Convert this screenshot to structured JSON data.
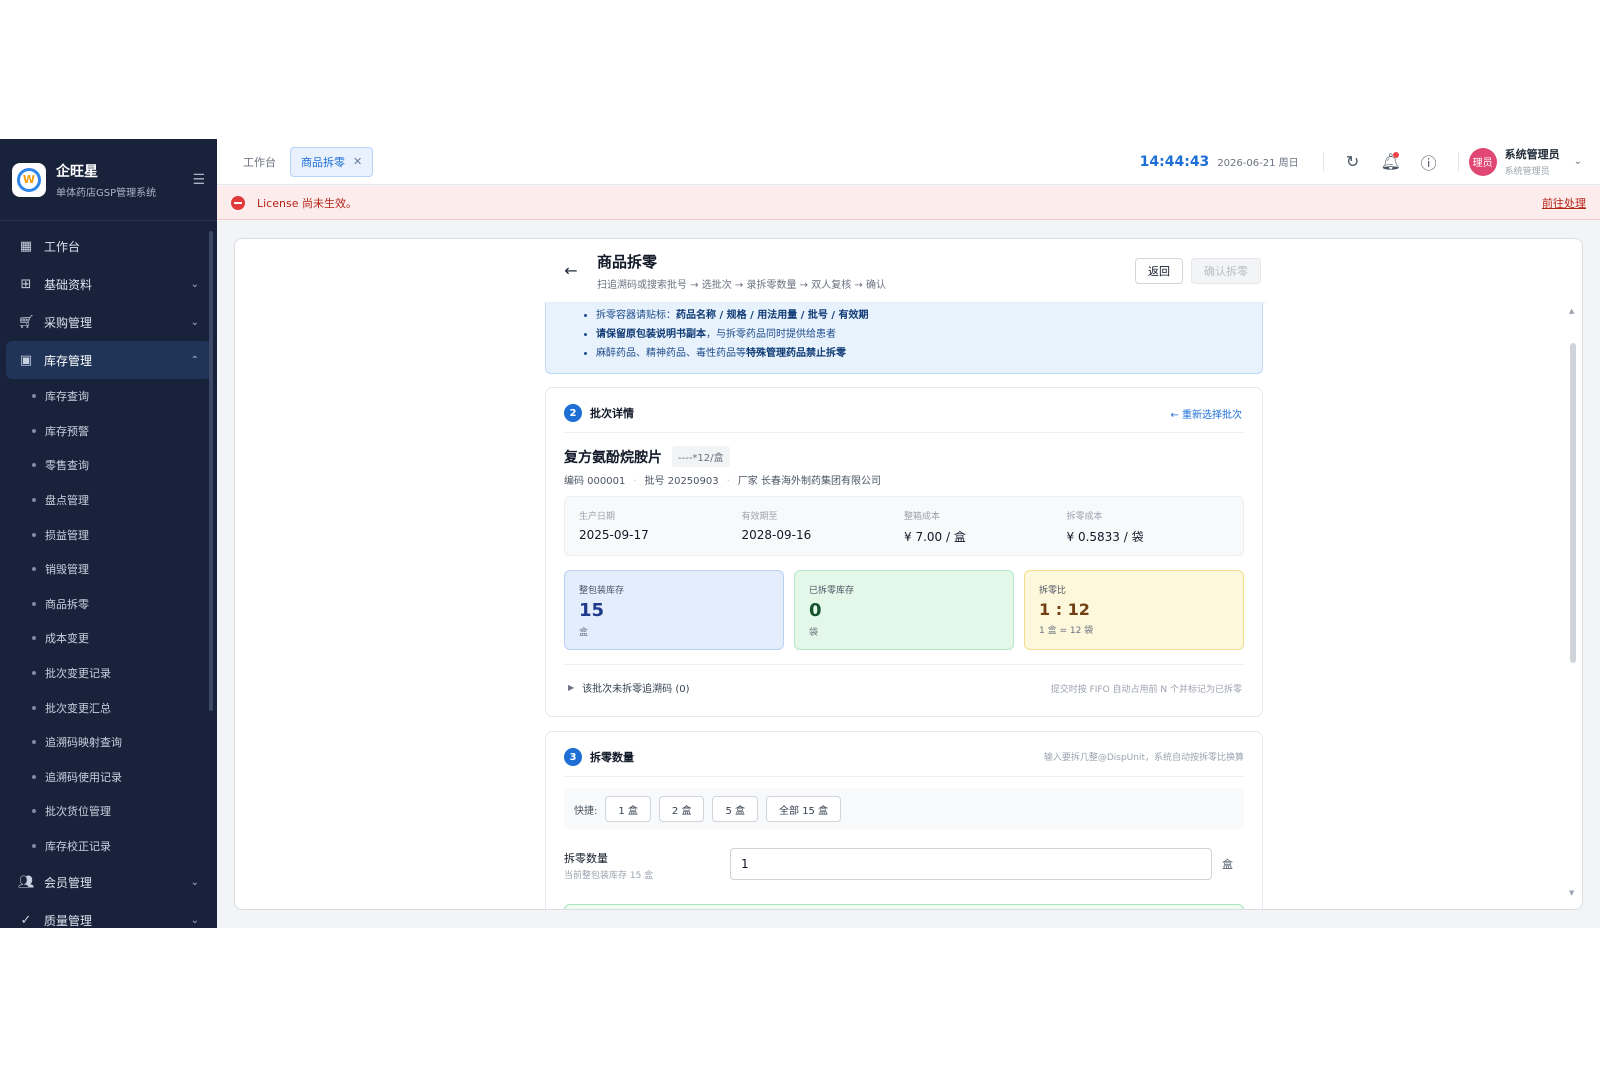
{
  "sidebar": {
    "brand_title": "企旺星",
    "brand_subtitle": "单体药店GSP管理系统",
    "logo_letter": "W",
    "items": [
      {
        "label": "工作台",
        "icon": "dashboard-icon"
      },
      {
        "label": "基础资料",
        "icon": "grid-icon"
      },
      {
        "label": "采购管理",
        "icon": "cart-icon"
      },
      {
        "label": "库存管理",
        "icon": "archive-icon"
      }
    ],
    "inventory_subitems": [
      "库存查询",
      "库存预警",
      "零售查询",
      "盘点管理",
      "损益管理",
      "销毁管理",
      "商品拆零",
      "成本变更",
      "批次变更记录",
      "批次变更汇总",
      "追溯码映射查询",
      "追溯码使用记录",
      "批次货位管理",
      "库存校正记录"
    ],
    "bottom_items": [
      {
        "label": "会员管理",
        "icon": "users-icon"
      },
      {
        "label": "质量管理",
        "icon": "check-circle-icon"
      }
    ]
  },
  "header": {
    "tab_home": "工作台",
    "tab_active": "商品拆零",
    "clock": "14:44:43",
    "date": "2026-06-21 周日",
    "user_avatar": "理员",
    "user_name": "系统管理员",
    "user_role": "系统管理员"
  },
  "banner": {
    "text": "License 尚未生效。",
    "link": "前往处理"
  },
  "page": {
    "title": "商品拆零",
    "subtitle": "扫追溯码或搜索批号 → 选批次 → 录拆零数量 → 双人复核 → 确认",
    "back_button": "返回",
    "confirm_button": "确认拆零"
  },
  "notice": {
    "line1_prefix": "拆零容器请贴标：",
    "line1_bold": "药品名称 / 规格 / 用法用量 / 批号 / 有效期",
    "line2_bold": "请保留原包装说明书副本",
    "line2_suffix": "，与拆零药品同时提供给患者",
    "line3_prefix": "麻醉药品、精神药品、毒性药品等",
    "line3_bold": "特殊管理药品禁止拆零"
  },
  "batch": {
    "step": "2",
    "title": "批次详情",
    "reselect_link": "← 重新选择批次",
    "drug_name": "复方氨酚烷胺片",
    "spec": "----*12/盒",
    "code": "编码 000001",
    "batch_no": "批号 20250903",
    "manufacturer": "厂家 长春海外制药集团有限公司",
    "info": [
      {
        "label": "生产日期",
        "value": "2025-09-17"
      },
      {
        "label": "有效期至",
        "value": "2028-09-16"
      },
      {
        "label": "整箱成本",
        "value": "¥ 7.00 / 盒"
      },
      {
        "label": "拆零成本",
        "value": "¥ 0.5833 / 袋"
      }
    ],
    "stats": {
      "whole_label": "整包装库存",
      "whole_value": "15",
      "whole_unit": "盒",
      "split_label": "已拆零库存",
      "split_value": "0",
      "split_unit": "袋",
      "ratio_label": "拆零比",
      "ratio_value": "1 : 12",
      "ratio_note": "1 盒 = 12 袋"
    },
    "trace_toggle": "该批次未拆零追溯码 (0)",
    "trace_note": "提交时按 FIFO 自动占用前 N 个并标记为已拆零"
  },
  "quantity": {
    "step": "3",
    "title": "拆零数量",
    "hint": "输入要拆几整@DispUnit，系统自动按拆零比换算",
    "quick_label": "快捷:",
    "quick_options": [
      "1 盒",
      "2 盒",
      "5 盒",
      "全部 15 盒"
    ],
    "field_label": "拆零数量",
    "field_sub": "当前整包装库存 15 盒",
    "field_value": "1",
    "field_unit": "盒"
  }
}
